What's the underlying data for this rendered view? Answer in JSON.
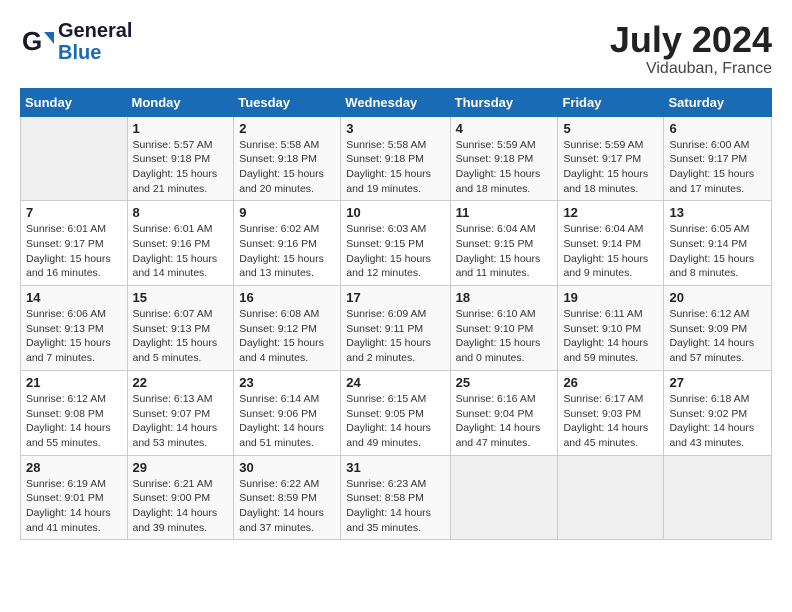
{
  "logo": {
    "general": "General",
    "blue": "Blue"
  },
  "title": "July 2024",
  "location": "Vidauban, France",
  "weekdays": [
    "Sunday",
    "Monday",
    "Tuesday",
    "Wednesday",
    "Thursday",
    "Friday",
    "Saturday"
  ],
  "weeks": [
    [
      {
        "day": "",
        "sunrise": "",
        "sunset": "",
        "daylight": ""
      },
      {
        "day": "1",
        "sunrise": "Sunrise: 5:57 AM",
        "sunset": "Sunset: 9:18 PM",
        "daylight": "Daylight: 15 hours and 21 minutes."
      },
      {
        "day": "2",
        "sunrise": "Sunrise: 5:58 AM",
        "sunset": "Sunset: 9:18 PM",
        "daylight": "Daylight: 15 hours and 20 minutes."
      },
      {
        "day": "3",
        "sunrise": "Sunrise: 5:58 AM",
        "sunset": "Sunset: 9:18 PM",
        "daylight": "Daylight: 15 hours and 19 minutes."
      },
      {
        "day": "4",
        "sunrise": "Sunrise: 5:59 AM",
        "sunset": "Sunset: 9:18 PM",
        "daylight": "Daylight: 15 hours and 18 minutes."
      },
      {
        "day": "5",
        "sunrise": "Sunrise: 5:59 AM",
        "sunset": "Sunset: 9:17 PM",
        "daylight": "Daylight: 15 hours and 18 minutes."
      },
      {
        "day": "6",
        "sunrise": "Sunrise: 6:00 AM",
        "sunset": "Sunset: 9:17 PM",
        "daylight": "Daylight: 15 hours and 17 minutes."
      }
    ],
    [
      {
        "day": "7",
        "sunrise": "Sunrise: 6:01 AM",
        "sunset": "Sunset: 9:17 PM",
        "daylight": "Daylight: 15 hours and 16 minutes."
      },
      {
        "day": "8",
        "sunrise": "Sunrise: 6:01 AM",
        "sunset": "Sunset: 9:16 PM",
        "daylight": "Daylight: 15 hours and 14 minutes."
      },
      {
        "day": "9",
        "sunrise": "Sunrise: 6:02 AM",
        "sunset": "Sunset: 9:16 PM",
        "daylight": "Daylight: 15 hours and 13 minutes."
      },
      {
        "day": "10",
        "sunrise": "Sunrise: 6:03 AM",
        "sunset": "Sunset: 9:15 PM",
        "daylight": "Daylight: 15 hours and 12 minutes."
      },
      {
        "day": "11",
        "sunrise": "Sunrise: 6:04 AM",
        "sunset": "Sunset: 9:15 PM",
        "daylight": "Daylight: 15 hours and 11 minutes."
      },
      {
        "day": "12",
        "sunrise": "Sunrise: 6:04 AM",
        "sunset": "Sunset: 9:14 PM",
        "daylight": "Daylight: 15 hours and 9 minutes."
      },
      {
        "day": "13",
        "sunrise": "Sunrise: 6:05 AM",
        "sunset": "Sunset: 9:14 PM",
        "daylight": "Daylight: 15 hours and 8 minutes."
      }
    ],
    [
      {
        "day": "14",
        "sunrise": "Sunrise: 6:06 AM",
        "sunset": "Sunset: 9:13 PM",
        "daylight": "Daylight: 15 hours and 7 minutes."
      },
      {
        "day": "15",
        "sunrise": "Sunrise: 6:07 AM",
        "sunset": "Sunset: 9:13 PM",
        "daylight": "Daylight: 15 hours and 5 minutes."
      },
      {
        "day": "16",
        "sunrise": "Sunrise: 6:08 AM",
        "sunset": "Sunset: 9:12 PM",
        "daylight": "Daylight: 15 hours and 4 minutes."
      },
      {
        "day": "17",
        "sunrise": "Sunrise: 6:09 AM",
        "sunset": "Sunset: 9:11 PM",
        "daylight": "Daylight: 15 hours and 2 minutes."
      },
      {
        "day": "18",
        "sunrise": "Sunrise: 6:10 AM",
        "sunset": "Sunset: 9:10 PM",
        "daylight": "Daylight: 15 hours and 0 minutes."
      },
      {
        "day": "19",
        "sunrise": "Sunrise: 6:11 AM",
        "sunset": "Sunset: 9:10 PM",
        "daylight": "Daylight: 14 hours and 59 minutes."
      },
      {
        "day": "20",
        "sunrise": "Sunrise: 6:12 AM",
        "sunset": "Sunset: 9:09 PM",
        "daylight": "Daylight: 14 hours and 57 minutes."
      }
    ],
    [
      {
        "day": "21",
        "sunrise": "Sunrise: 6:12 AM",
        "sunset": "Sunset: 9:08 PM",
        "daylight": "Daylight: 14 hours and 55 minutes."
      },
      {
        "day": "22",
        "sunrise": "Sunrise: 6:13 AM",
        "sunset": "Sunset: 9:07 PM",
        "daylight": "Daylight: 14 hours and 53 minutes."
      },
      {
        "day": "23",
        "sunrise": "Sunrise: 6:14 AM",
        "sunset": "Sunset: 9:06 PM",
        "daylight": "Daylight: 14 hours and 51 minutes."
      },
      {
        "day": "24",
        "sunrise": "Sunrise: 6:15 AM",
        "sunset": "Sunset: 9:05 PM",
        "daylight": "Daylight: 14 hours and 49 minutes."
      },
      {
        "day": "25",
        "sunrise": "Sunrise: 6:16 AM",
        "sunset": "Sunset: 9:04 PM",
        "daylight": "Daylight: 14 hours and 47 minutes."
      },
      {
        "day": "26",
        "sunrise": "Sunrise: 6:17 AM",
        "sunset": "Sunset: 9:03 PM",
        "daylight": "Daylight: 14 hours and 45 minutes."
      },
      {
        "day": "27",
        "sunrise": "Sunrise: 6:18 AM",
        "sunset": "Sunset: 9:02 PM",
        "daylight": "Daylight: 14 hours and 43 minutes."
      }
    ],
    [
      {
        "day": "28",
        "sunrise": "Sunrise: 6:19 AM",
        "sunset": "Sunset: 9:01 PM",
        "daylight": "Daylight: 14 hours and 41 minutes."
      },
      {
        "day": "29",
        "sunrise": "Sunrise: 6:21 AM",
        "sunset": "Sunset: 9:00 PM",
        "daylight": "Daylight: 14 hours and 39 minutes."
      },
      {
        "day": "30",
        "sunrise": "Sunrise: 6:22 AM",
        "sunset": "Sunset: 8:59 PM",
        "daylight": "Daylight: 14 hours and 37 minutes."
      },
      {
        "day": "31",
        "sunrise": "Sunrise: 6:23 AM",
        "sunset": "Sunset: 8:58 PM",
        "daylight": "Daylight: 14 hours and 35 minutes."
      },
      {
        "day": "",
        "sunrise": "",
        "sunset": "",
        "daylight": ""
      },
      {
        "day": "",
        "sunrise": "",
        "sunset": "",
        "daylight": ""
      },
      {
        "day": "",
        "sunrise": "",
        "sunset": "",
        "daylight": ""
      }
    ]
  ]
}
